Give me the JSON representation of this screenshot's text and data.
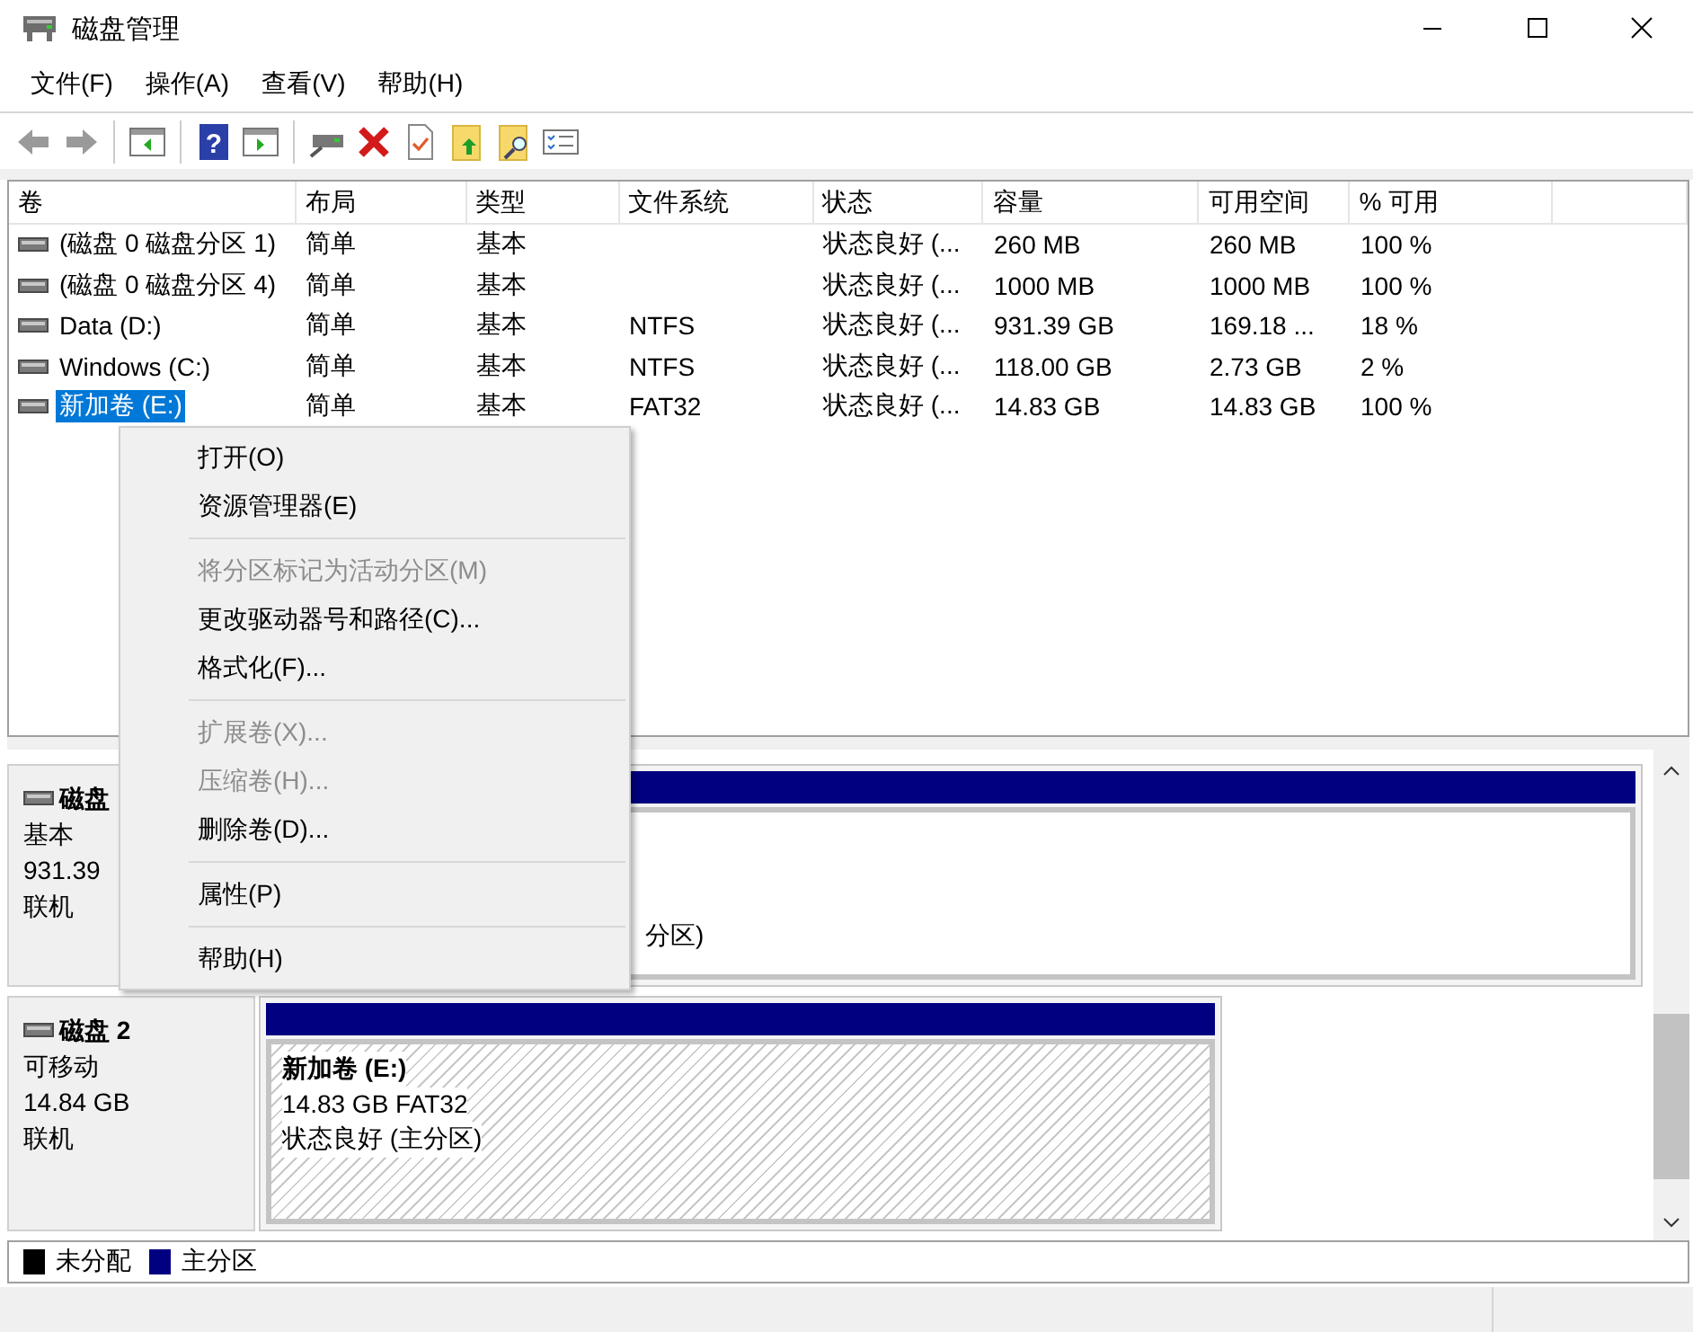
{
  "window": {
    "title": "磁盘管理"
  },
  "toolbar": {
    "help_button": "?"
  },
  "menu_bar": [
    "文件(F)",
    "操作(A)",
    "查看(V)",
    "帮助(H)"
  ],
  "volume_table": {
    "columns": [
      "卷",
      "布局",
      "类型",
      "文件系统",
      "状态",
      "容量",
      "可用空间",
      "% 可用"
    ],
    "rows": [
      {
        "volume": "(磁盘 0 磁盘分区 1)",
        "layout": "简单",
        "type": "基本",
        "status": "状态良好 (...",
        "capacity": "260 MB",
        "free": "260 MB",
        "percent": "100 %",
        "selected": false
      },
      {
        "volume": "(磁盘 0 磁盘分区 4)",
        "layout": "简单",
        "type": "基本",
        "status": "状态良好 (...",
        "capacity": "1000 MB",
        "free": "1000 MB",
        "percent": "100 %",
        "selected": false
      },
      {
        "volume": "Data (D:)",
        "layout": "简单",
        "type": "基本",
        "file_system": "NTFS",
        "status": "状态良好 (...",
        "capacity": "931.39 GB",
        "free": "169.18 ...",
        "percent": "18 %",
        "selected": false
      },
      {
        "volume": "Windows (C:)",
        "layout": "简单",
        "type": "基本",
        "file_system": "NTFS",
        "status": "状态良好 (...",
        "capacity": "118.00 GB",
        "free": "2.73 GB",
        "percent": "2 %",
        "selected": false
      },
      {
        "volume": "新加卷 (E:)",
        "layout": "简单",
        "type": "基本",
        "file_system": "FAT32",
        "status": "状态良好 (...",
        "capacity": "14.83 GB",
        "free": "14.83 GB",
        "percent": "100 %",
        "selected": true
      }
    ]
  },
  "disks": [
    {
      "name": "磁盘",
      "type": "基本",
      "size": "931.39",
      "status": "联机",
      "partitions": [
        {
          "status": "分区)",
          "selected": false
        }
      ]
    },
    {
      "name": "磁盘 2",
      "type": "可移动",
      "size": "14.84 GB",
      "status": "联机",
      "partitions": [
        {
          "name": "新加卷 (E:)",
          "size": "14.83 GB FAT32",
          "status": "状态良好 (主分区)",
          "selected": true
        }
      ]
    }
  ],
  "legend": [
    {
      "label": "未分配",
      "color": "#000000"
    },
    {
      "label": "主分区",
      "color": "#000080"
    }
  ],
  "context_menu": [
    [
      {
        "label": "打开(O)",
        "disabled": false
      },
      {
        "label": "资源管理器(E)",
        "disabled": false
      }
    ],
    [
      {
        "label": "将分区标记为活动分区(M)",
        "disabled": true
      },
      {
        "label": "更改驱动器号和路径(C)...",
        "disabled": false
      },
      {
        "label": "格式化(F)...",
        "disabled": false
      }
    ],
    [
      {
        "label": "扩展卷(X)...",
        "disabled": true
      },
      {
        "label": "压缩卷(H)...",
        "disabled": true
      },
      {
        "label": "删除卷(D)...",
        "disabled": false
      }
    ],
    [
      {
        "label": "属性(P)",
        "disabled": false
      }
    ],
    [
      {
        "label": "帮助(H)",
        "disabled": false
      }
    ]
  ]
}
